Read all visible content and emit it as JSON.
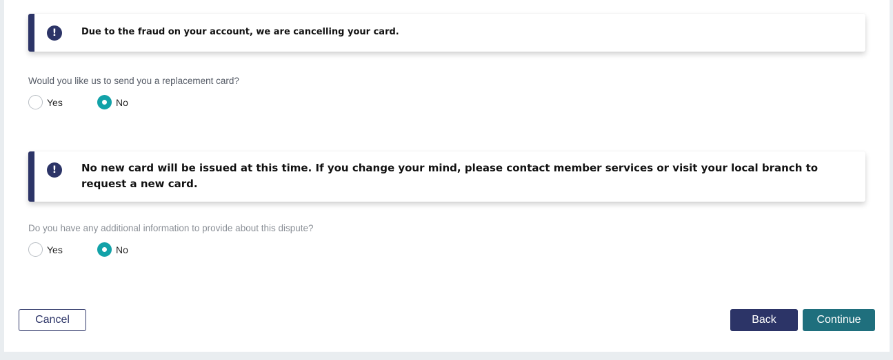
{
  "fraud_alert": {
    "icon": "exclamation-icon",
    "message": "Due to the fraud on your account, we are cancelling your card."
  },
  "replacement_question": {
    "label": "Would you like us to send you a replacement card?",
    "options": [
      {
        "label": "Yes",
        "selected": false
      },
      {
        "label": "No",
        "selected": true
      }
    ]
  },
  "no_card_alert": {
    "icon": "exclamation-icon",
    "message": "No new card will be issued at this time. If you change your mind, please contact member services or visit your local branch to request a new card."
  },
  "additional_info_question": {
    "label": "Do you have any additional information to provide about this dispute?",
    "options": [
      {
        "label": "Yes",
        "selected": false
      },
      {
        "label": "No",
        "selected": true
      }
    ]
  },
  "actions": {
    "cancel_label": "Cancel",
    "back_label": "Back",
    "continue_label": "Continue"
  },
  "colors": {
    "navy": "#2c3467",
    "teal_radio": "#12a2a8",
    "teal_button": "#1f6f7d"
  }
}
